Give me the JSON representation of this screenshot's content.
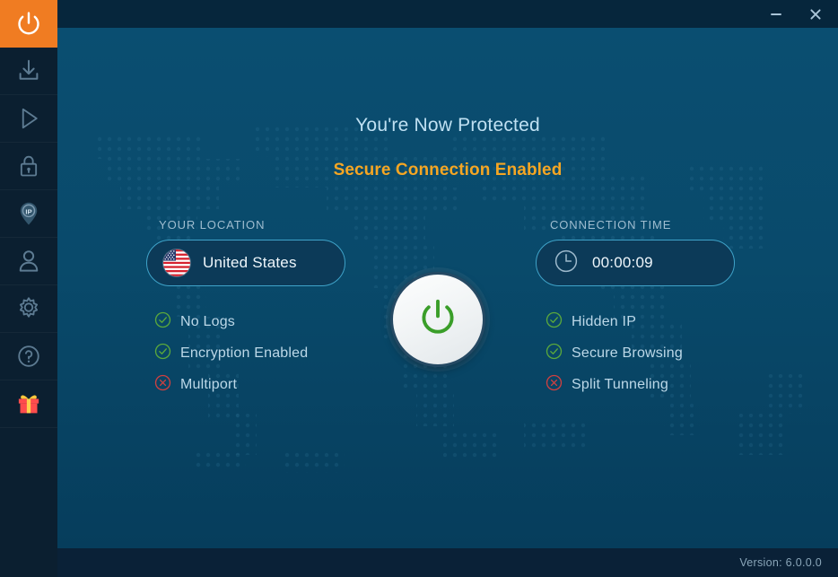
{
  "window": {
    "minimize_label": "Minimize",
    "close_label": "Close"
  },
  "sidebar": {
    "items": [
      {
        "icon": "power-icon",
        "name": "power",
        "active": true
      },
      {
        "icon": "download-icon",
        "name": "download",
        "active": false
      },
      {
        "icon": "play-icon",
        "name": "play",
        "active": false
      },
      {
        "icon": "lock-icon",
        "name": "lock",
        "active": false
      },
      {
        "icon": "ip-pin-icon",
        "name": "ip",
        "active": false
      },
      {
        "icon": "user-icon",
        "name": "account",
        "active": false
      },
      {
        "icon": "gear-icon",
        "name": "settings",
        "active": false
      },
      {
        "icon": "help-icon",
        "name": "help",
        "active": false
      },
      {
        "icon": "gift-icon",
        "name": "gift",
        "active": false
      }
    ]
  },
  "main": {
    "headline": "You're Now Protected",
    "subheadline": "Secure Connection Enabled",
    "location": {
      "label": "YOUR LOCATION",
      "value": "United States",
      "flag": "us-flag-icon"
    },
    "connection_time": {
      "label": "CONNECTION TIME",
      "value": "00:00:09",
      "icon": "clock-icon"
    },
    "power_button": {
      "state": "on",
      "icon": "power-icon"
    },
    "features_left": [
      {
        "label": "No Logs",
        "status": "enabled"
      },
      {
        "label": "Encryption Enabled",
        "status": "enabled"
      },
      {
        "label": "Multiport",
        "status": "disabled"
      }
    ],
    "features_right": [
      {
        "label": "Hidden IP",
        "status": "enabled"
      },
      {
        "label": "Secure Browsing",
        "status": "enabled"
      },
      {
        "label": "Split Tunneling",
        "status": "disabled"
      }
    ]
  },
  "footer": {
    "version": "Version:  6.0.0.0"
  },
  "colors": {
    "accent_orange": "#f07c22",
    "subhead_orange": "#f5a623",
    "enabled_green": "#4aa832",
    "disabled_red": "#cf4040",
    "pill_border": "#3fa3c9",
    "stage_blue": "#094a6b",
    "titlebar_navy": "#06263c",
    "sidebar_navy": "#0b1f30"
  }
}
